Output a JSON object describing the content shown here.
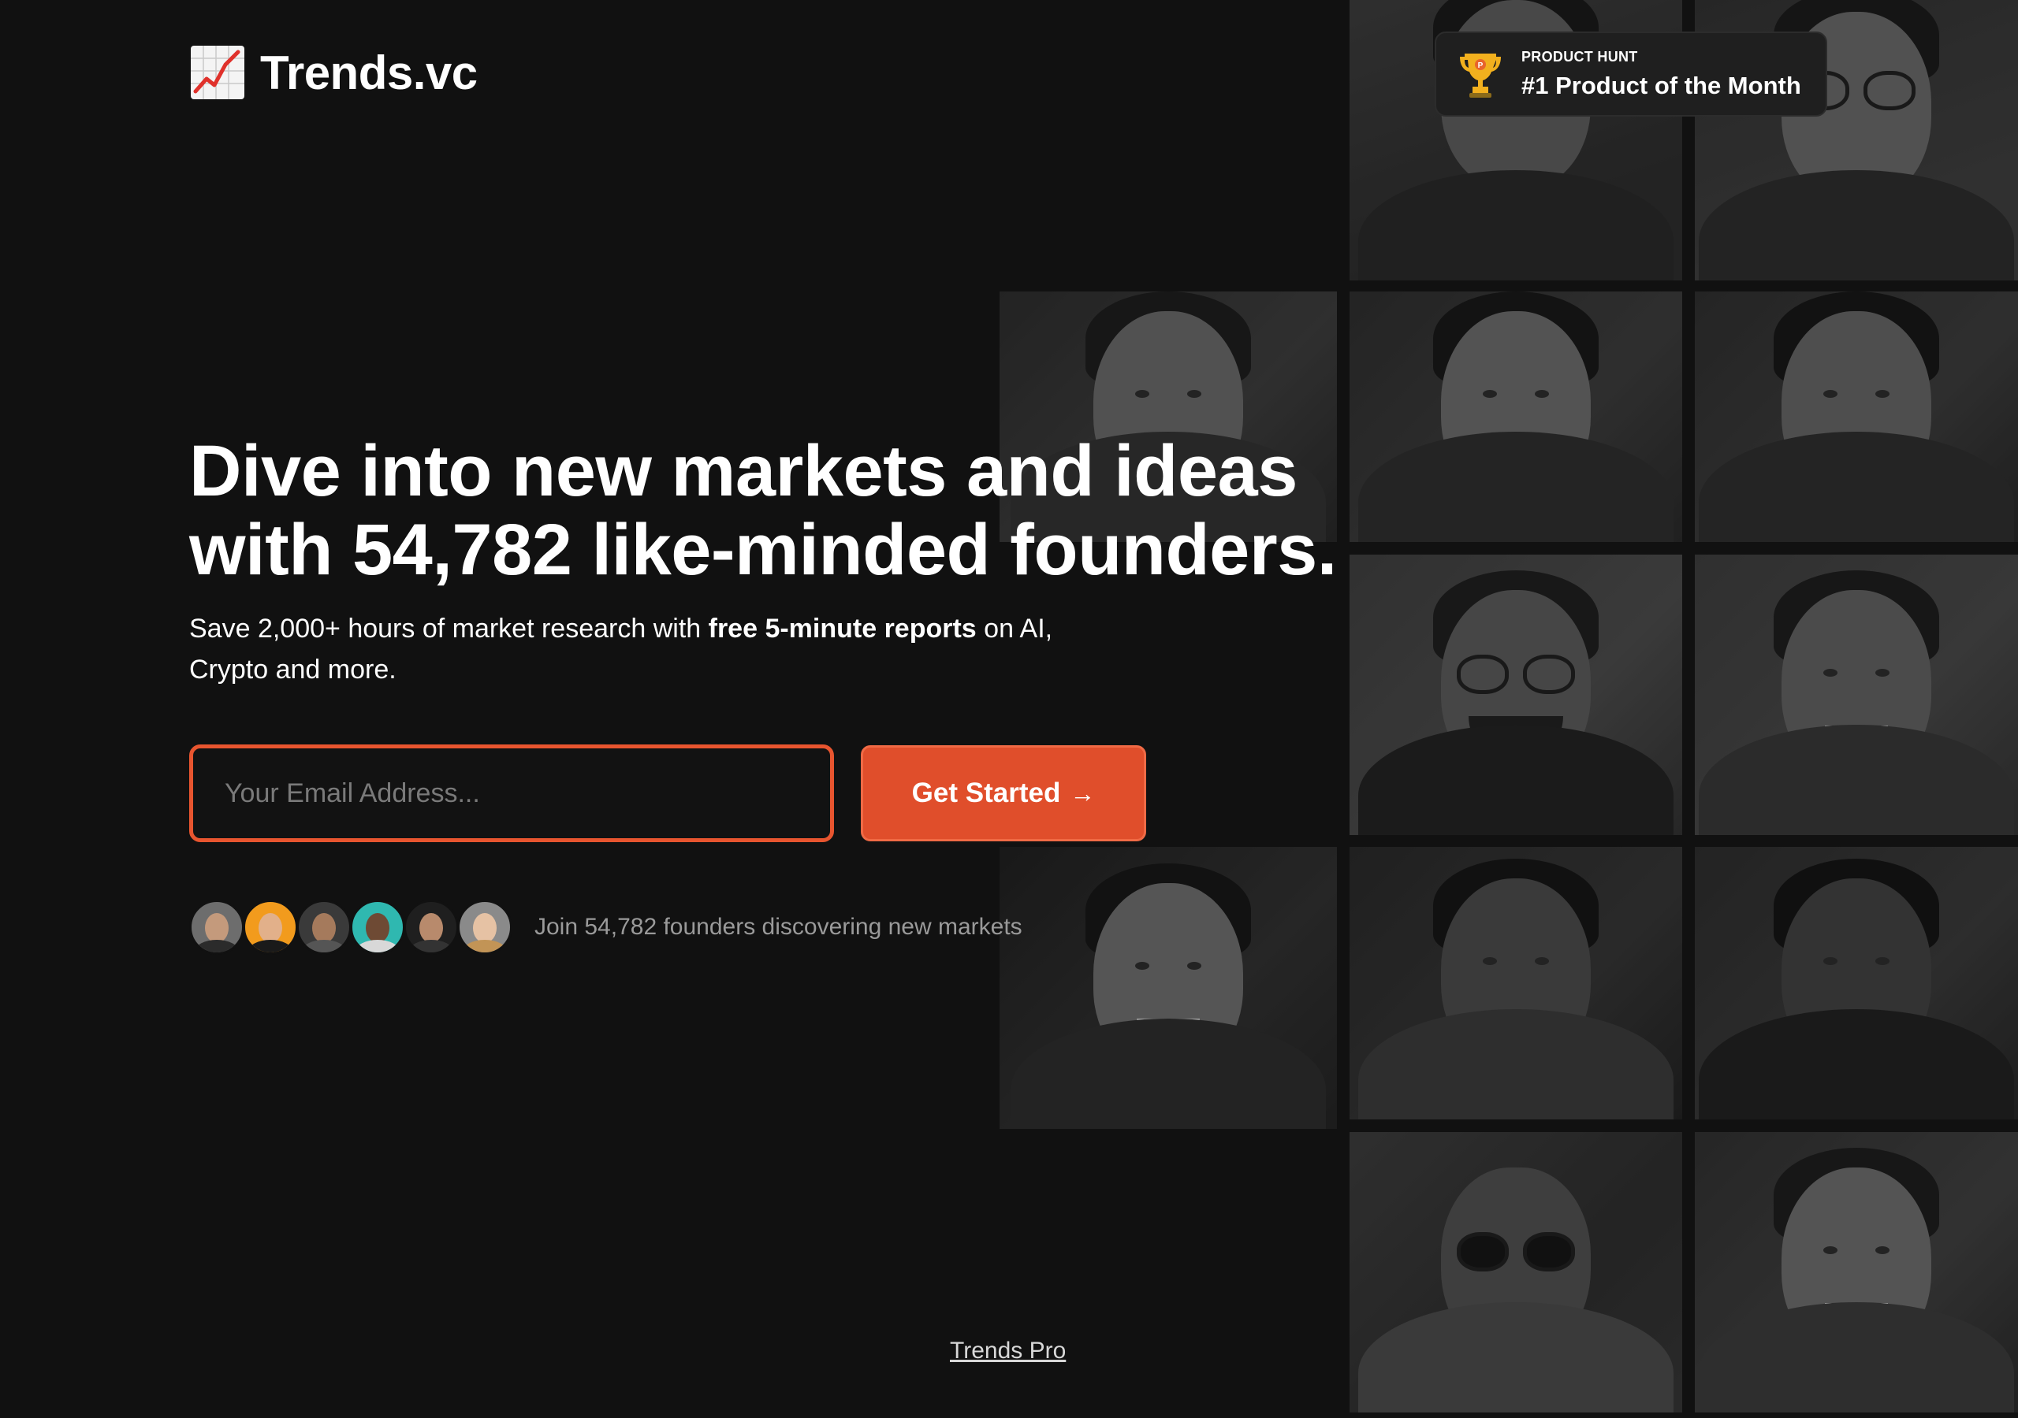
{
  "header": {
    "logo_text": "Trends.vc",
    "logo_icon": "chart-increasing-icon"
  },
  "product_hunt_badge": {
    "kicker": "PRODUCT HUNT",
    "title": "#1 Product of the Month",
    "icon": "trophy-icon"
  },
  "hero": {
    "title_line1": "Dive into new markets and ideas",
    "title_line2": "with 54,782 like-minded founders.",
    "subtitle_part1": "Save 2,000+ hours of market research with ",
    "subtitle_bold": "free 5-minute reports",
    "subtitle_part2": " on AI,",
    "subtitle_line2": "Crypto and more."
  },
  "signup": {
    "email_placeholder": "Your Email Address...",
    "button_label": "Get Started",
    "button_arrow": "→"
  },
  "social_proof": {
    "text": "Join 54,782 founders discovering new markets"
  },
  "footer": {
    "link_label": "Trends Pro"
  },
  "colors": {
    "background": "#111111",
    "accent": "#e04e2b",
    "input_border": "#e8552f",
    "badge_bg": "#1f1f1f",
    "muted_text": "#9a9a9a"
  }
}
